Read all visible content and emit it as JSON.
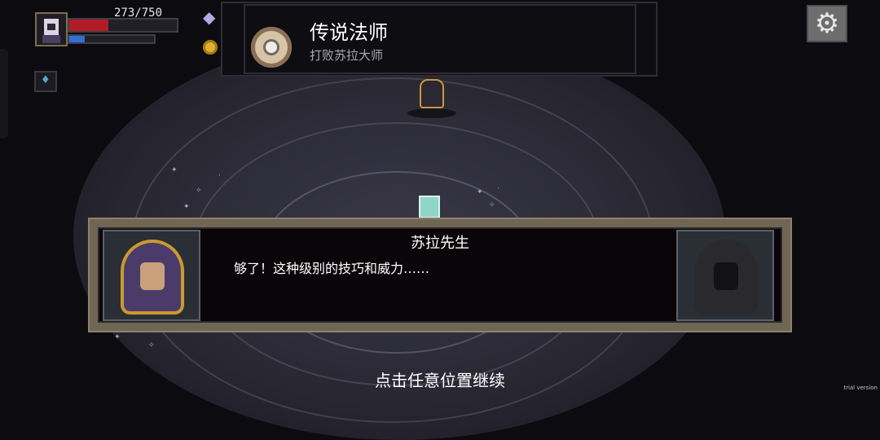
{
  "hud": {
    "hp_text": "273/750",
    "hp_fraction": 0.36,
    "mp_fraction": 0.18,
    "icons": {
      "portrait": "player-portrait-icon",
      "crystal": "purple-crystal-icon",
      "coin": "gold-coin-icon",
      "skill": "skill-slot-icon",
      "settings": "gear-icon"
    },
    "colors": {
      "hp": "#b11c26",
      "mp": "#2f6fd6"
    }
  },
  "achievement": {
    "title": "传说法师",
    "subtitle": "打败苏拉大师"
  },
  "dialogue": {
    "speaker": "苏拉先生",
    "line": "够了！这种级别的技巧和威力……"
  },
  "footer": {
    "continue_hint": "点击任意位置继续",
    "watermark": "trial version"
  }
}
